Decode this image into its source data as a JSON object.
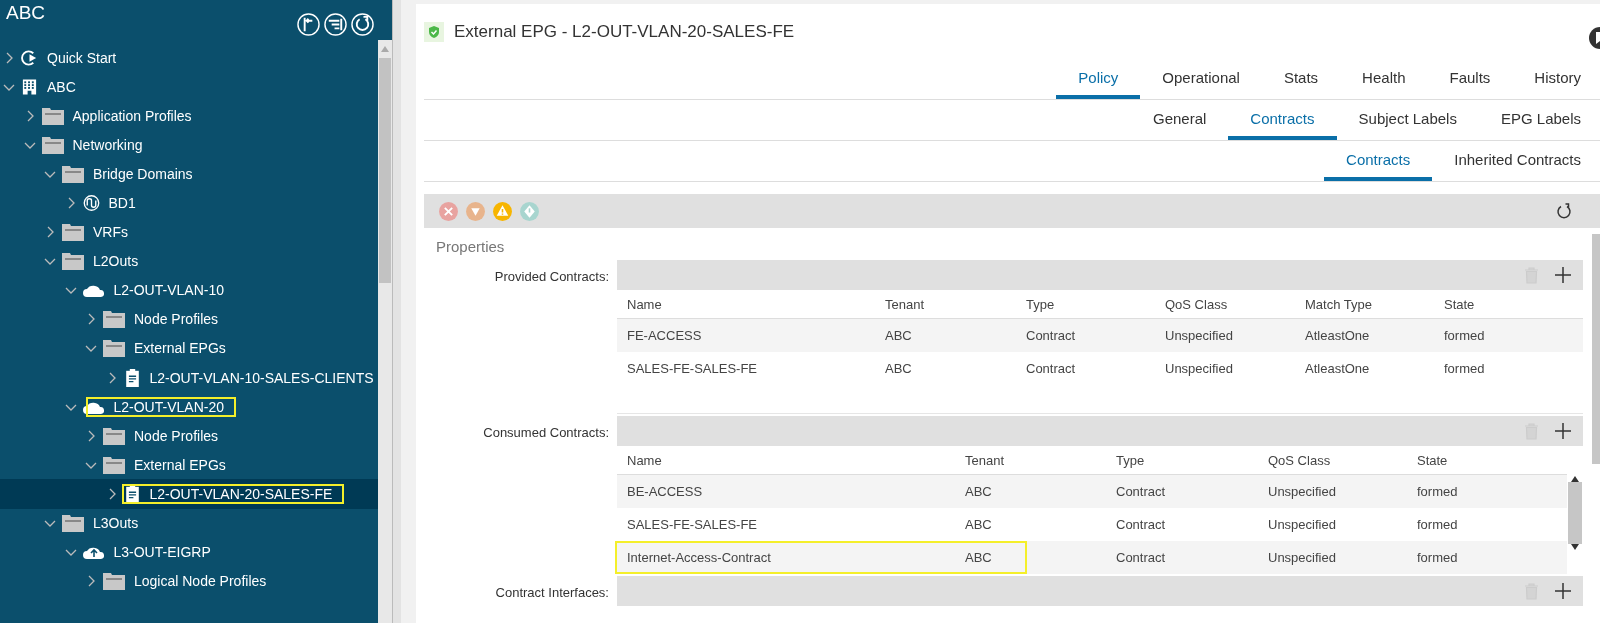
{
  "sidebar": {
    "title": "ABC",
    "tree": [
      {
        "label": "Quick Start",
        "kind": "quickstart",
        "expanded": false,
        "selected": false,
        "highlighted": false
      },
      {
        "label": "ABC",
        "kind": "tenant",
        "expanded": true,
        "selected": false,
        "highlighted": false,
        "children": [
          {
            "label": "Application Profiles",
            "kind": "folder",
            "expanded": false,
            "selected": false,
            "highlighted": false
          },
          {
            "label": "Networking",
            "kind": "folder",
            "expanded": true,
            "selected": false,
            "highlighted": false,
            "children": [
              {
                "label": "Bridge Domains",
                "kind": "folder",
                "expanded": true,
                "selected": false,
                "highlighted": false,
                "children": [
                  {
                    "label": "BD1",
                    "kind": "bd",
                    "expanded": false,
                    "selected": false,
                    "highlighted": false
                  }
                ]
              },
              {
                "label": "VRFs",
                "kind": "folder",
                "expanded": false,
                "selected": false,
                "highlighted": false
              },
              {
                "label": "L2Outs",
                "kind": "folder",
                "expanded": true,
                "selected": false,
                "highlighted": false,
                "children": [
                  {
                    "label": "L2-OUT-VLAN-10",
                    "kind": "cloud",
                    "expanded": true,
                    "selected": false,
                    "highlighted": false,
                    "children": [
                      {
                        "label": "Node Profiles",
                        "kind": "folder",
                        "expanded": false,
                        "selected": false,
                        "highlighted": false
                      },
                      {
                        "label": "External EPGs",
                        "kind": "folder",
                        "expanded": true,
                        "selected": false,
                        "highlighted": false,
                        "children": [
                          {
                            "label": "L2-OUT-VLAN-10-SALES-CLIENTS",
                            "kind": "epg",
                            "expanded": false,
                            "selected": false,
                            "highlighted": false
                          }
                        ]
                      }
                    ]
                  },
                  {
                    "label": "L2-OUT-VLAN-20",
                    "kind": "cloud",
                    "expanded": true,
                    "selected": false,
                    "highlighted": true,
                    "children": [
                      {
                        "label": "Node Profiles",
                        "kind": "folder",
                        "expanded": false,
                        "selected": false,
                        "highlighted": false
                      },
                      {
                        "label": "External EPGs",
                        "kind": "folder",
                        "expanded": true,
                        "selected": false,
                        "highlighted": false,
                        "children": [
                          {
                            "label": "L2-OUT-VLAN-20-SALES-FE",
                            "kind": "epg",
                            "expanded": false,
                            "selected": true,
                            "highlighted": true
                          }
                        ]
                      }
                    ]
                  }
                ]
              },
              {
                "label": "L3Outs",
                "kind": "folder",
                "expanded": true,
                "selected": false,
                "highlighted": false,
                "children": [
                  {
                    "label": "L3-OUT-EIGRP",
                    "kind": "cloud-up",
                    "expanded": true,
                    "selected": false,
                    "highlighted": false,
                    "children": [
                      {
                        "label": "Logical Node Profiles",
                        "kind": "folder",
                        "expanded": false,
                        "selected": false,
                        "highlighted": false
                      }
                    ]
                  }
                ]
              }
            ]
          }
        ]
      }
    ]
  },
  "page": {
    "title": "External EPG - L2-OUT-VLAN-20-SALES-FE",
    "tabs": [
      {
        "label": "Policy",
        "selected": true
      },
      {
        "label": "Operational",
        "selected": false
      },
      {
        "label": "Stats",
        "selected": false
      },
      {
        "label": "Health",
        "selected": false
      },
      {
        "label": "Faults",
        "selected": false
      },
      {
        "label": "History",
        "selected": false
      }
    ],
    "subtabs": [
      {
        "label": "General",
        "selected": false
      },
      {
        "label": "Contracts",
        "selected": true
      },
      {
        "label": "Subject Labels",
        "selected": false
      },
      {
        "label": "EPG Labels",
        "selected": false
      }
    ],
    "subsubtabs": [
      {
        "label": "Contracts",
        "selected": true
      },
      {
        "label": "Inherited Contracts",
        "selected": false
      }
    ],
    "section": "Properties",
    "tables": [
      {
        "label": "Provided Contracts:",
        "columns": [
          "Name",
          "Tenant",
          "Type",
          "QoS Class",
          "Match Type",
          "State"
        ],
        "rows": [
          {
            "cells": [
              "FE-ACCESS",
              "ABC",
              "Contract",
              "Unspecified",
              "AtleastOne",
              "formed"
            ],
            "highlighted": false
          },
          {
            "cells": [
              "SALES-FE-SALES-FE",
              "ABC",
              "Contract",
              "Unspecified",
              "AtleastOne",
              "formed"
            ],
            "highlighted": false
          }
        ]
      },
      {
        "label": "Consumed Contracts:",
        "columns": [
          "Name",
          "Tenant",
          "Type",
          "QoS Class",
          "State"
        ],
        "rows": [
          {
            "cells": [
              "BE-ACCESS",
              "ABC",
              "Contract",
              "Unspecified",
              "formed"
            ],
            "highlighted": false
          },
          {
            "cells": [
              "SALES-FE-SALES-FE",
              "ABC",
              "Contract",
              "Unspecified",
              "formed"
            ],
            "highlighted": false
          },
          {
            "cells": [
              "Internet-Access-Contract",
              "ABC",
              "Contract",
              "Unspecified",
              "formed"
            ],
            "highlighted": true
          }
        ]
      },
      {
        "label": "Contract Interfaces:"
      }
    ]
  }
}
